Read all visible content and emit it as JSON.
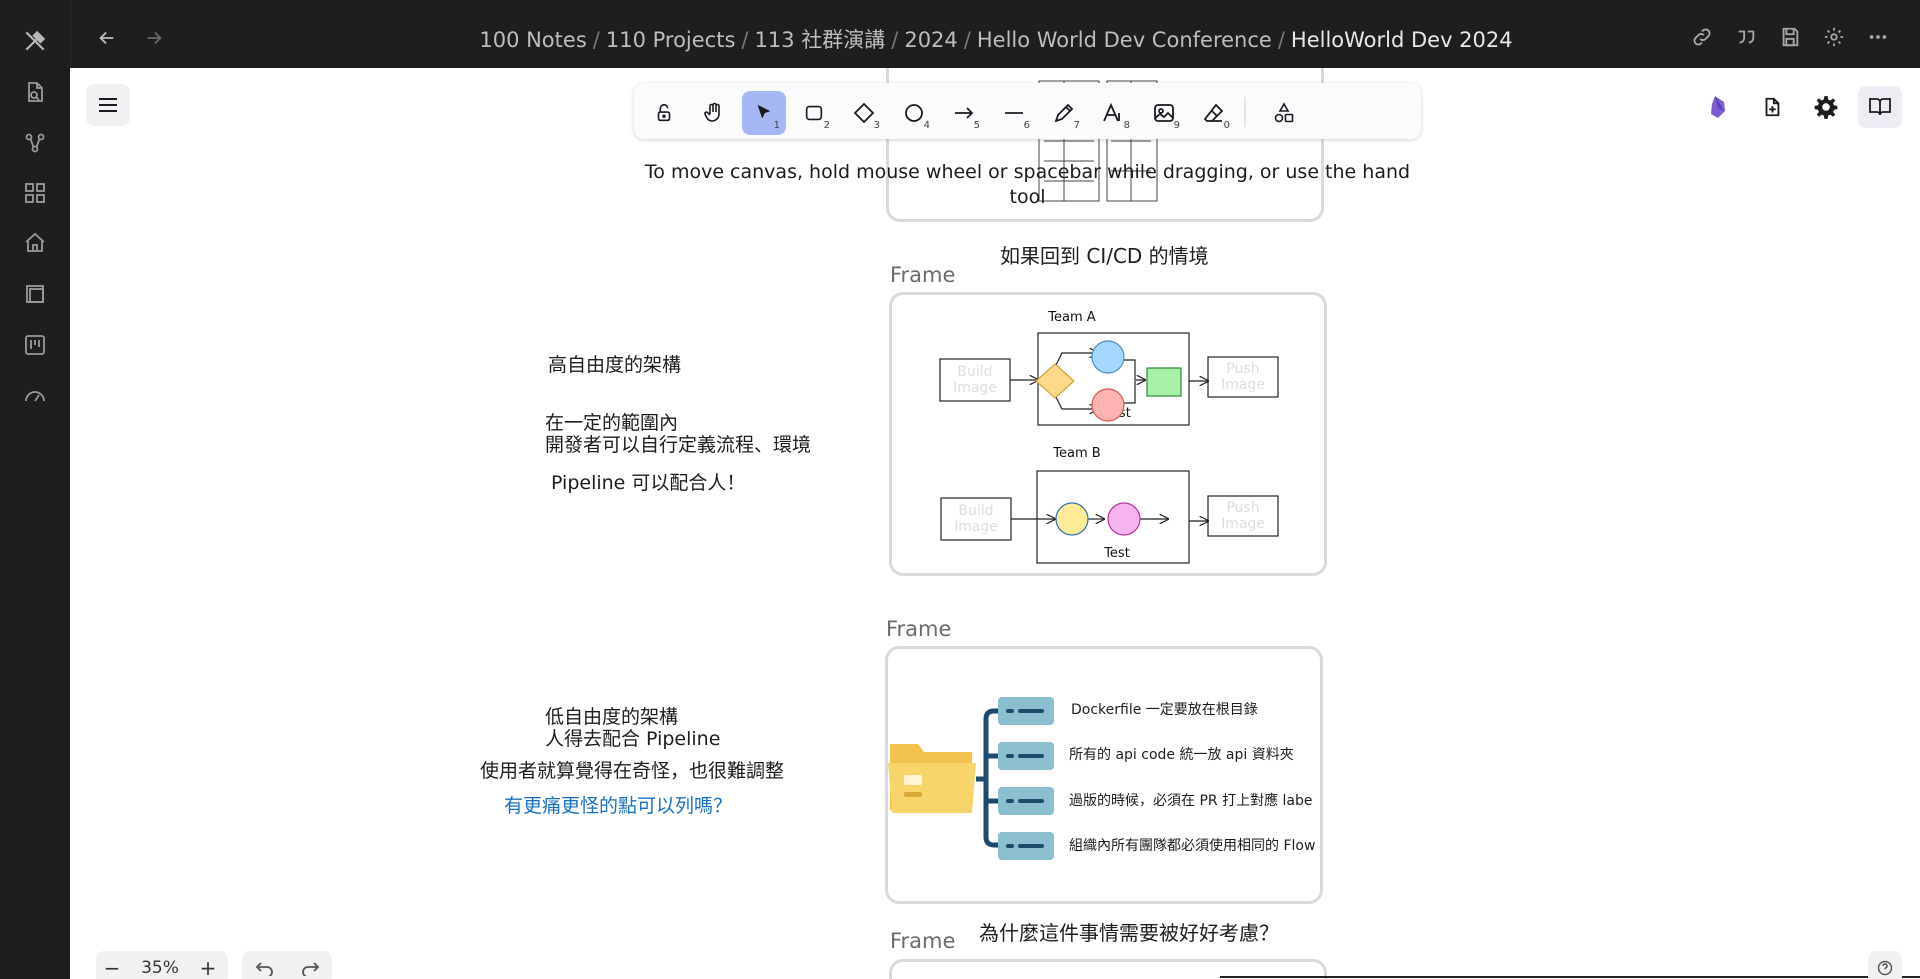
{
  "ribbon": {
    "icons": [
      "excalidraw-icon",
      "file-search-icon",
      "graph-icon",
      "dashboard-icon",
      "home-icon",
      "layers-icon",
      "kanban-icon",
      "gauge-icon"
    ]
  },
  "header": {
    "breadcrumbs": [
      "100 Notes",
      "110 Projects",
      "113 社群演講",
      "2024",
      "Hello World Dev Conference",
      "HelloWorld Dev 2024"
    ],
    "actions": [
      "link-icon",
      "quote-icon",
      "save-icon",
      "settings-icon",
      "more-icon"
    ]
  },
  "toolbar": {
    "tools": [
      {
        "name": "lock-tool",
        "key": ""
      },
      {
        "name": "hand-tool",
        "key": ""
      },
      {
        "name": "selection-tool",
        "key": "1"
      },
      {
        "name": "rectangle-tool",
        "key": "2"
      },
      {
        "name": "diamond-tool",
        "key": "3"
      },
      {
        "name": "ellipse-tool",
        "key": "4"
      },
      {
        "name": "arrow-tool",
        "key": "5"
      },
      {
        "name": "line-tool",
        "key": "6"
      },
      {
        "name": "draw-tool",
        "key": "7"
      },
      {
        "name": "text-tool",
        "key": "8"
      },
      {
        "name": "image-tool",
        "key": "9"
      },
      {
        "name": "eraser-tool",
        "key": "0"
      },
      {
        "name": "shapes-library-tool",
        "key": ""
      }
    ],
    "active": "selection-tool",
    "hint": "To move canvas, hold mouse wheel or spacebar while dragging, or use the hand tool"
  },
  "canvas": {
    "frame_label": "Frame",
    "cicd_title": "如果回到 CI/CD 的情境",
    "team_a": "Team A",
    "team_b": "Team B",
    "build_image": "Build\nImage",
    "push_image": "Push\nImage",
    "test_label": "Test",
    "high_freedom": {
      "title": "高自由度的架構",
      "line1": "在一定的範圍內",
      "line2": "開發者可以自行定義流程、環境",
      "line3": "Pipeline 可以配合人！"
    },
    "low_freedom": {
      "title": "低自由度的架構",
      "line1": "人得去配合 Pipeline",
      "line2": "使用者就算覺得在奇怪，也很難調整",
      "question": "有更痛更怪的點可以列嗎？"
    },
    "rules": [
      "Dockerfile 一定要放在根目錄",
      "所有的 api code 統一放 api 資料夾",
      "過版的時候，必須在 PR 打上對應 labe",
      "組織內所有團隊都必須使用相同的 Flow"
    ],
    "bottom_title": "為什麼這件事情需要被好好考慮？"
  },
  "zoom": {
    "minus": "−",
    "value": "35%",
    "plus": "+"
  },
  "colors": {
    "accent": "#a5b8f5",
    "link": "#1971c2",
    "frame_border": "#d9d9d9"
  }
}
